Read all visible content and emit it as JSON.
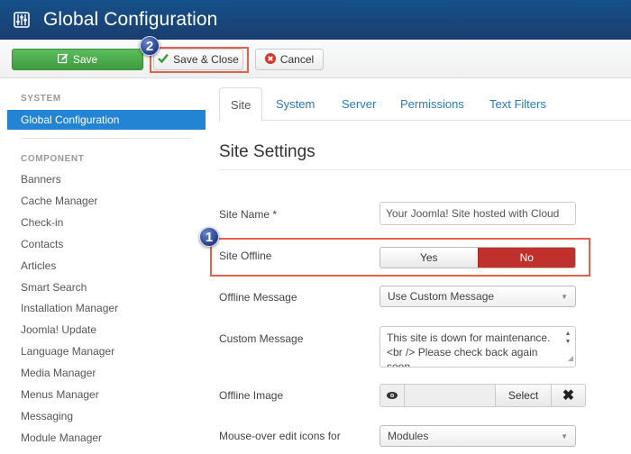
{
  "header": {
    "title": "Global Configuration",
    "icon": "sliders-icon"
  },
  "toolbar": {
    "save_label": "Save",
    "save_close_label": "Save & Close",
    "cancel_label": "Cancel",
    "colors": {
      "save": "#46a546",
      "cancel_icon": "#d9342b",
      "check_icon": "#3c9a3c"
    }
  },
  "annotations": {
    "badge_1": "1",
    "badge_2": "2",
    "highlight_color": "#e5624a"
  },
  "sidebar": {
    "system_heading": "SYSTEM",
    "active_item": "Global Configuration",
    "component_heading": "COMPONENT",
    "items": [
      "Banners",
      "Cache Manager",
      "Check-in",
      "Contacts",
      "Articles",
      "Smart Search",
      "Installation Manager",
      "Joomla! Update",
      "Language Manager",
      "Media Manager",
      "Menus Manager",
      "Messaging",
      "Module Manager"
    ]
  },
  "tabs": [
    {
      "label": "Site",
      "active": true
    },
    {
      "label": "System",
      "active": false
    },
    {
      "label": "Server",
      "active": false
    },
    {
      "label": "Permissions",
      "active": false
    },
    {
      "label": "Text Filters",
      "active": false
    }
  ],
  "section": {
    "title": "Site Settings"
  },
  "form": {
    "site_name": {
      "label": "Site Name *",
      "value": "Your Joomla! Site hosted with Cloud"
    },
    "site_offline": {
      "label": "Site Offline",
      "yes": "Yes",
      "no": "No",
      "selected": "No"
    },
    "offline_message": {
      "label": "Offline Message",
      "value": "Use Custom Message"
    },
    "custom_message": {
      "label": "Custom Message",
      "value": "This site is down for maintenance.<br /> Please check back again soon."
    },
    "offline_image": {
      "label": "Offline Image",
      "select_label": "Select",
      "clear_label": "✖",
      "value": ""
    },
    "mouseover_edit": {
      "label": "Mouse-over edit icons for",
      "value": "Modules"
    }
  }
}
